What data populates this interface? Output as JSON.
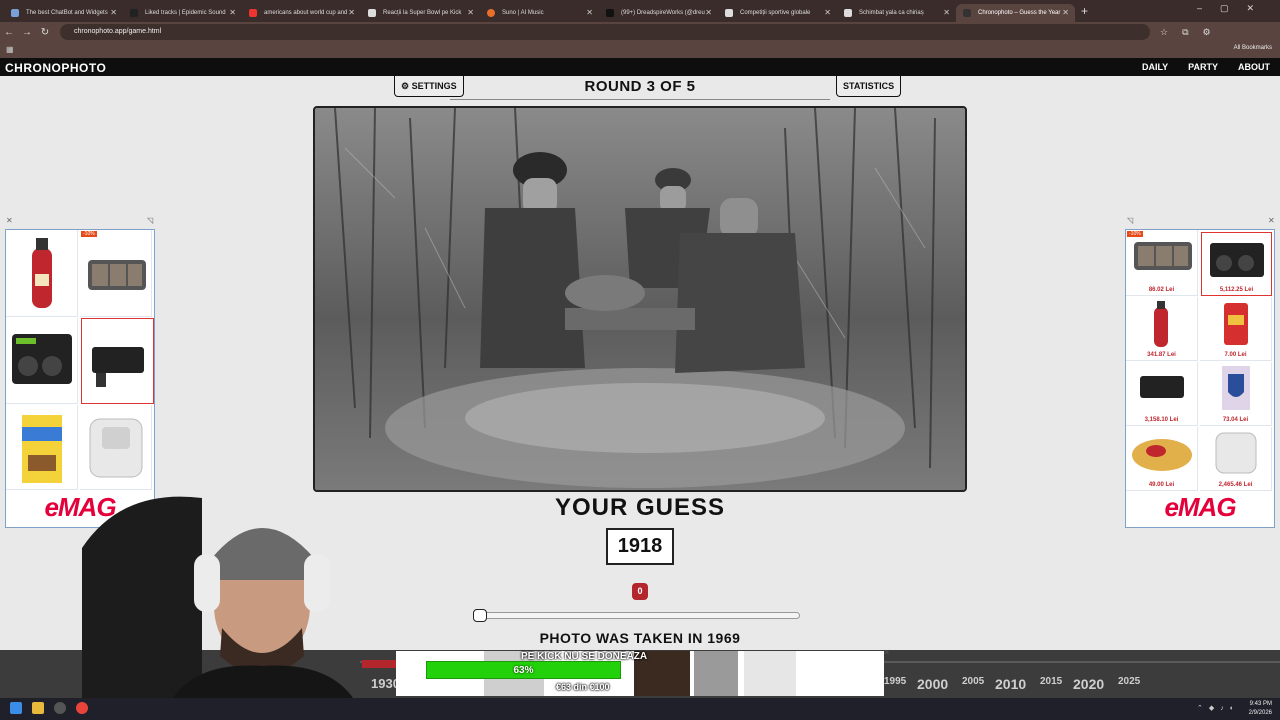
{
  "browser": {
    "tabs": [
      {
        "title": "The best ChatBot and Widgets"
      },
      {
        "title": "Liked tracks | Epidemic Sound"
      },
      {
        "title": "americans about world cup and"
      },
      {
        "title": "Reacții la Super Bowl pe Kick"
      },
      {
        "title": "Suno | AI Music"
      },
      {
        "title": "(99+) DreadspireWorks (@dreu"
      },
      {
        "title": "Competiții sportive globale"
      },
      {
        "title": "Schimbat yala ca chiriaș"
      },
      {
        "title": "Chronophoto – Guess the Year"
      }
    ],
    "url": "chronophoto.app/game.html",
    "bookmarks_label": "All Bookmarks"
  },
  "site": {
    "logo": "CHRONOPHOTO",
    "nav": [
      "DAILY",
      "PARTY",
      "ABOUT"
    ]
  },
  "game": {
    "settings_label": "⚙ SETTINGS",
    "statistics_label": "STATISTICS",
    "round_label": "ROUND 3 OF 5",
    "your_guess_label": "YOUR GUESS",
    "guess_value": "1918",
    "score": "0",
    "slider_fraction": 0.0,
    "photo_taken_label": "PHOTO WAS TAKEN IN 1969"
  },
  "ads": {
    "left": {
      "discount": "-10%",
      "brand": "eMAG"
    },
    "right": {
      "discount": "-10%",
      "brand": "eMAG",
      "prices": [
        "86.02 Lei",
        "5,112.25 Lei",
        "341.87 Lei",
        "7.00 Lei",
        "3,158.10 Lei",
        "73.04 Lei",
        "49.00 Lei",
        "2,465.46 Lei"
      ]
    }
  },
  "kick_widget": {
    "title": "PE KICK NU SE DONEAZA",
    "progress_label": "63%",
    "progress_fraction": 0.63,
    "count": "€63 din €100"
  },
  "timeline": {
    "years": [
      "1930",
      "1995",
      "2000",
      "2005",
      "2010",
      "2015",
      "2020",
      "2025"
    ]
  },
  "taskbar": {
    "time": "9:43 PM",
    "date": "2/9/2026"
  },
  "colors": {
    "accent_red": "#b3262c",
    "emag_red": "#e4003a",
    "kick_green": "#23d10a"
  }
}
